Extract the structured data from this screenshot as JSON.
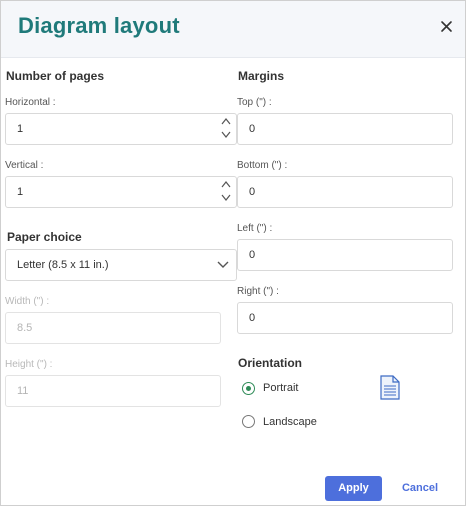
{
  "dialog": {
    "title": "Diagram layout",
    "close_icon": "close-icon"
  },
  "pages": {
    "section_title": "Number of pages",
    "horizontal": {
      "label": "Horizontal :",
      "value": "1"
    },
    "vertical": {
      "label": "Vertical :",
      "value": "1"
    }
  },
  "paper": {
    "section_title": "Paper choice",
    "selected": "Letter (8.5 x 11 in.)",
    "width": {
      "label": "Width (\") :",
      "value": "8.5"
    },
    "height": {
      "label": "Height (\") :",
      "value": "11"
    }
  },
  "margins": {
    "section_title": "Margins",
    "top": {
      "label": "Top (\") :",
      "value": "0"
    },
    "bottom": {
      "label": "Bottom (\") :",
      "value": "0"
    },
    "left": {
      "label": "Left (\") :",
      "value": "0"
    },
    "right": {
      "label": "Right (\") :",
      "value": "0"
    }
  },
  "orientation": {
    "section_title": "Orientation",
    "options": [
      {
        "label": "Portrait",
        "checked": true
      },
      {
        "label": "Landscape",
        "checked": false
      }
    ],
    "preview_icon": "portrait-page-icon"
  },
  "buttons": {
    "apply": "Apply",
    "cancel": "Cancel"
  },
  "colors": {
    "title": "#1f7a7a",
    "primary": "#4d6fdc",
    "radio_checked": "#2e8b57"
  }
}
